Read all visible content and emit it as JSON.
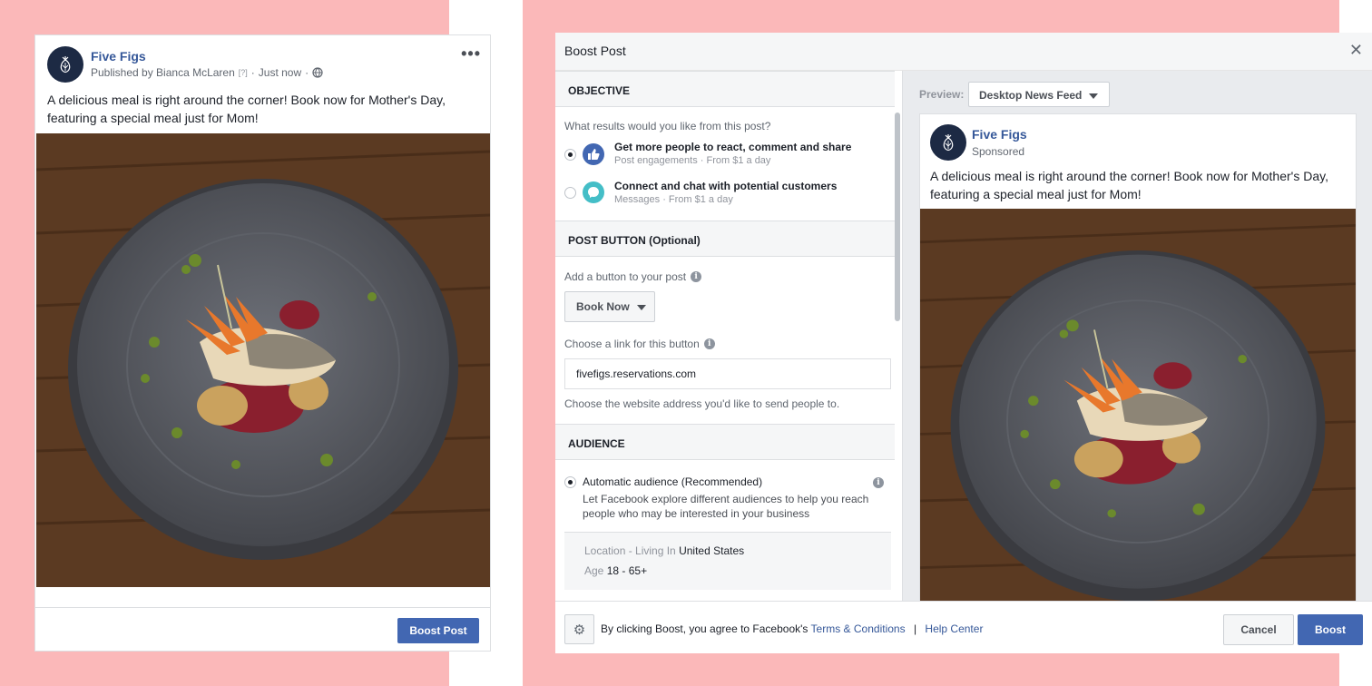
{
  "colors": {
    "background_pink": "#fbb8b9",
    "accent": "#4267b2",
    "link": "#365899"
  },
  "post": {
    "page_name": "Five Figs",
    "published_by": "Published by Bianca McLaren",
    "help_mark": "[?]",
    "time": "Just now",
    "separator": "·",
    "text": "A delicious meal is right around the corner! Book now for Mother's Day, featuring a special meal just for Mom!",
    "more_icon": "•••",
    "boost_button": "Boost Post"
  },
  "dialog": {
    "title": "Boost Post",
    "close_icon": "✕",
    "objective": {
      "heading": "OBJECTIVE",
      "question": "What results would you like from this post?",
      "options": [
        {
          "title": "Get more people to react, comment and share",
          "subtitle": "Post engagements · From $1 a day",
          "icon": "thumbs-up-icon",
          "selected": true
        },
        {
          "title": "Connect and chat with potential customers",
          "subtitle": "Messages · From $1 a day",
          "icon": "messenger-icon",
          "selected": false
        }
      ]
    },
    "post_button": {
      "heading": "POST BUTTON (Optional)",
      "add_label": "Add a button to your post",
      "selected_button": "Book Now",
      "link_label": "Choose a link for this button",
      "link_value": "fivefigs.reservations.com",
      "link_help": "Choose the website address you'd like to send people to."
    },
    "audience": {
      "heading": "AUDIENCE",
      "option_title": "Automatic audience (Recommended)",
      "option_desc": "Let Facebook explore different audiences to help you reach people who may be interested in your business",
      "location_label": "Location - Living In",
      "location_value": "United States",
      "age_label": "Age",
      "age_value": "18 - 65+"
    },
    "preview": {
      "label": "Preview:",
      "placement": "Desktop News Feed",
      "page_name": "Five Figs",
      "sponsored": "Sponsored",
      "text": "A delicious meal is right around the corner! Book now for Mother's Day, featuring a special meal just for Mom!"
    },
    "footer": {
      "settings_icon": "⚙",
      "agree_text": "By clicking Boost, you agree to Facebook's",
      "terms_link": "Terms & Conditions",
      "divider": "|",
      "help_link": "Help Center",
      "cancel": "Cancel",
      "boost": "Boost"
    }
  }
}
